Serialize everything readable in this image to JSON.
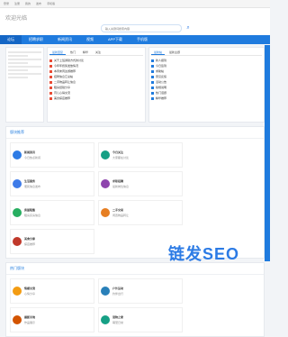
{
  "topbar": {
    "links": [
      "登录",
      "注册",
      "我的",
      "发布",
      "手机版"
    ]
  },
  "header": {
    "logo": "欢迎光临",
    "search_placeholder": "输入关键词搜索内容"
  },
  "nav": {
    "items": [
      "论坛",
      "招聘求职",
      "新闻资讯",
      "视频",
      "APP下载",
      "手机版"
    ],
    "active": 0
  },
  "colors": {
    "primary": "#1f7bde",
    "nav_active": "#1466c5",
    "icon_red": "#e94b35"
  },
  "section_one": {
    "tabs": [
      "最新回复",
      "热门",
      "精华",
      "关注"
    ],
    "list": [
      "关于上班通勤方式的讨论",
      "今年年终奖发放情况",
      "本周末周边游推荐",
      "招聘信息汇总帖",
      "二手物品转让信息",
      "租房经验分享",
      "育儿心得交流",
      "美食探店推荐"
    ]
  },
  "section_two": {
    "tabs": [
      "最新帖",
      "最新主题"
    ],
    "list": [
      "新人报到",
      "今日签到",
      "求助帖",
      "意见反馈",
      "活动公告",
      "版规说明",
      "热门话题",
      "精华推荐"
    ]
  },
  "section_three_title": "版块推荐",
  "section_three_cards": [
    {
      "name": "新闻资讯",
      "sub": "今日热点新闻",
      "color": "#2d7be5"
    },
    {
      "name": "今日关注",
      "sub": "大家都在讨论",
      "color": "#16a085"
    },
    {
      "name": "生活服务",
      "sub": "便民信息发布",
      "color": "#3e7be8"
    },
    {
      "name": "求职招聘",
      "sub": "最新岗位信息",
      "color": "#8e44ad"
    },
    {
      "name": "房屋租售",
      "sub": "租房买房信息",
      "color": "#27ae60"
    },
    {
      "name": "二手交易",
      "sub": "闲置物品转让",
      "color": "#e67e22"
    },
    {
      "name": "美食分享",
      "sub": "探店推荐",
      "color": "#c0392b"
    }
  ],
  "section_four_title": "热门版块",
  "section_four_cards": [
    {
      "name": "情感交流",
      "sub": "心情分享",
      "color": "#f39c12"
    },
    {
      "name": "户外运动",
      "sub": "约伴出行",
      "color": "#2980b9"
    },
    {
      "name": "摄影天地",
      "sub": "作品展示",
      "color": "#d35400"
    },
    {
      "name": "宠物之家",
      "sub": "萌宠日常",
      "color": "#16a085"
    }
  ],
  "watermark": "链发SEO"
}
